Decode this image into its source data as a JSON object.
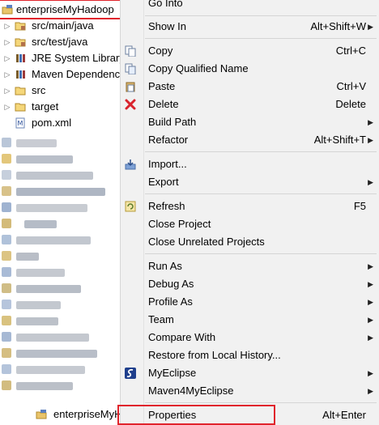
{
  "tree": {
    "root_label": "enterpriseMyHadoop",
    "items": [
      {
        "label": "src/main/java",
        "icon": "source-folder-icon"
      },
      {
        "label": "src/test/java",
        "icon": "source-folder-icon"
      },
      {
        "label": "JRE System Library",
        "icon": "library-icon"
      },
      {
        "label": "Maven Dependencies",
        "icon": "library-icon"
      },
      {
        "label": "src",
        "icon": "folder-icon"
      },
      {
        "label": "target",
        "icon": "folder-icon"
      },
      {
        "label": "pom.xml",
        "icon": "maven-file-icon"
      }
    ],
    "bottom_label": "enterpriseMyHadoop"
  },
  "menu": {
    "items": [
      {
        "label": "Go Into",
        "accel": "",
        "submenu": false,
        "icon": ""
      },
      {
        "label": "Show In",
        "accel": "Alt+Shift+W",
        "submenu": true,
        "icon": ""
      },
      {
        "label": "Copy",
        "accel": "Ctrl+C",
        "submenu": false,
        "icon": "copy-icon"
      },
      {
        "label": "Copy Qualified Name",
        "accel": "",
        "submenu": false,
        "icon": "copy-qualified-icon"
      },
      {
        "label": "Paste",
        "accel": "Ctrl+V",
        "submenu": false,
        "icon": "paste-icon"
      },
      {
        "label": "Delete",
        "accel": "Delete",
        "submenu": false,
        "icon": "delete-icon"
      },
      {
        "label": "Build Path",
        "accel": "",
        "submenu": true,
        "icon": ""
      },
      {
        "label": "Refactor",
        "accel": "Alt+Shift+T",
        "submenu": true,
        "icon": ""
      },
      {
        "label": "Import...",
        "accel": "",
        "submenu": false,
        "icon": "import-icon"
      },
      {
        "label": "Export",
        "accel": "",
        "submenu": true,
        "icon": ""
      },
      {
        "label": "Refresh",
        "accel": "F5",
        "submenu": false,
        "icon": "refresh-icon"
      },
      {
        "label": "Close Project",
        "accel": "",
        "submenu": false,
        "icon": ""
      },
      {
        "label": "Close Unrelated Projects",
        "accel": "",
        "submenu": false,
        "icon": ""
      },
      {
        "label": "Run As",
        "accel": "",
        "submenu": true,
        "icon": ""
      },
      {
        "label": "Debug As",
        "accel": "",
        "submenu": true,
        "icon": ""
      },
      {
        "label": "Profile As",
        "accel": "",
        "submenu": true,
        "icon": ""
      },
      {
        "label": "Team",
        "accel": "",
        "submenu": true,
        "icon": ""
      },
      {
        "label": "Compare With",
        "accel": "",
        "submenu": true,
        "icon": ""
      },
      {
        "label": "Restore from Local History...",
        "accel": "",
        "submenu": false,
        "icon": ""
      },
      {
        "label": "MyEclipse",
        "accel": "",
        "submenu": true,
        "icon": "myeclipse-icon"
      },
      {
        "label": "Maven4MyEclipse",
        "accel": "",
        "submenu": true,
        "icon": ""
      },
      {
        "label": "Properties",
        "accel": "Alt+Enter",
        "submenu": false,
        "icon": ""
      }
    ],
    "submenu_glyph": "▶",
    "highlight_color": "#e0242c"
  }
}
